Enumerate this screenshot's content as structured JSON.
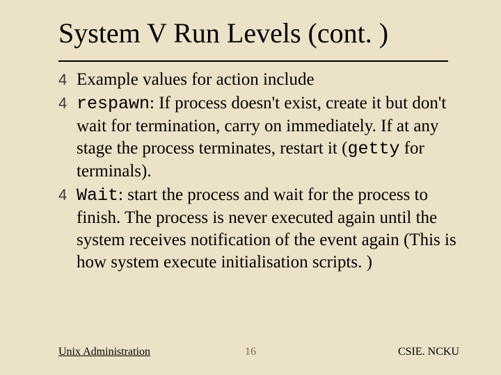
{
  "title": "System V Run Levels (cont. )",
  "bullets": {
    "b0": "Example values for action include",
    "b1_code": "respawn",
    "b1_rest": ": If process doesn't exist, create it but don't wait for termination, carry on immediately.  If at any stage the process terminates, restart it (",
    "b1_code2": "getty",
    "b1_rest2": " for terminals).",
    "b2_code": "Wait",
    "b2_rest": ": start the process and wait for the process to finish. The process is never executed again until the system receives notification of the event again (This is how system execute initialisation scripts. )"
  },
  "footer": {
    "left": "Unix Administration",
    "center": "16",
    "right": "CSIE. NCKU"
  }
}
